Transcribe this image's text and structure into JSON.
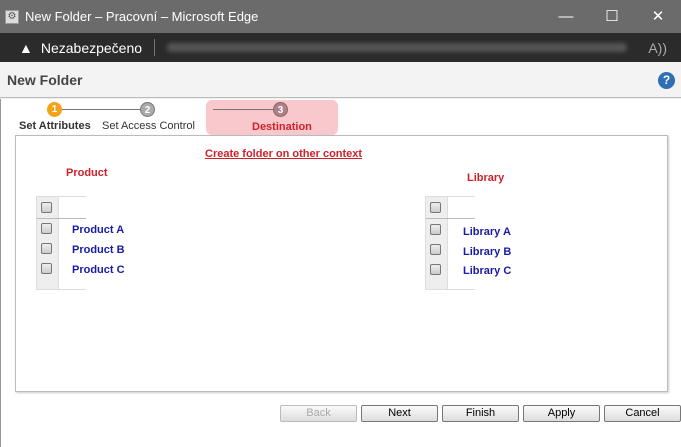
{
  "window": {
    "title": "New Folder – Pracovní – Microsoft Edge",
    "minimize": "—",
    "maximize": "☐",
    "close": "✕"
  },
  "address": {
    "security_text": "Nezabezpečeno",
    "read_aloud": "A))"
  },
  "header": {
    "title": "New Folder",
    "help": "?"
  },
  "steps": [
    {
      "num": "1",
      "label": "Set Attributes"
    },
    {
      "num": "2",
      "label": "Set Access Control"
    },
    {
      "num": "3",
      "label": "Destination"
    }
  ],
  "panel": {
    "link": "Create folder on other context",
    "product_title": "Product",
    "library_title": "Library",
    "products": [
      "Product A",
      "Product B",
      "Product C"
    ],
    "libraries": [
      "Library A",
      "Library B",
      "Library C"
    ]
  },
  "buttons": {
    "back": "Back",
    "next": "Next",
    "finish": "Finish",
    "apply": "Apply",
    "cancel": "Cancel"
  },
  "colors": {
    "active_step": "#f5a21b",
    "accent_red": "#d0202a",
    "link_blue": "#1a1aa6"
  }
}
